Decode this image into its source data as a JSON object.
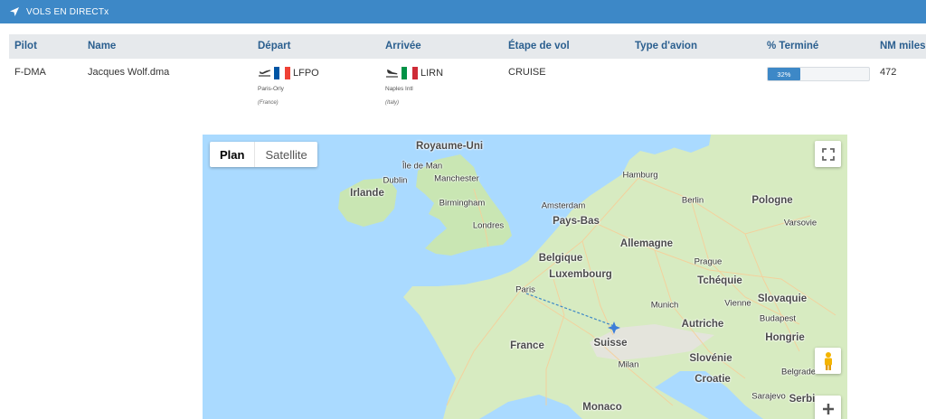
{
  "header": {
    "title": "VOLS EN DIRECTx",
    "icon": "navigation-arrow-icon",
    "color": "#3d88c7"
  },
  "table": {
    "columns": [
      "Pilot",
      "Name",
      "Départ",
      "Arrivée",
      "Étape de vol",
      "Type d'avion",
      "% Terminé",
      "NM miles a"
    ],
    "row": {
      "pilot": "F-DMA",
      "name": "Jacques Wolf.dma",
      "departure": {
        "code": "LFPO",
        "name": "Paris-Orly",
        "country": "(France)",
        "flag": "france-flag-icon"
      },
      "arrival": {
        "code": "LIRN",
        "name": "Naples Intl",
        "country": "(Italy)",
        "flag": "italy-flag-icon"
      },
      "phase": "CRUISE",
      "aircraft": "",
      "progress_label": "32%",
      "progress": 0.32,
      "nm": "472"
    }
  },
  "map": {
    "type_buttons": [
      "Plan",
      "Satellite"
    ],
    "active_type": "Plan",
    "labels": {
      "uk": "Royaume-Uni",
      "iom": "Île de Man",
      "ireland": "Irlande",
      "dublin": "Dublin",
      "manchester": "Manchester",
      "birmingham": "Birmingham",
      "london": "Londres",
      "hamburg": "Hamburg",
      "berlin": "Berlin",
      "poland": "Pologne",
      "warsaw": "Varsovie",
      "amsterdam": "Amsterdam",
      "netherlands": "Pays-Bas",
      "germany": "Allemagne",
      "belgium": "Belgique",
      "luxembourg": "Luxembourg",
      "prague": "Prague",
      "czech": "Tchéquie",
      "paris": "Paris",
      "munich": "Munich",
      "vienna": "Vienne",
      "slovakia": "Slovaquie",
      "budapest": "Budapest",
      "austria": "Autriche",
      "hungary": "Hongrie",
      "france": "France",
      "switzerland": "Suisse",
      "slovenia": "Slovénie",
      "milan": "Milan",
      "croatia": "Croatie",
      "belgrade": "Belgrade",
      "sarajevo": "Sarajevo",
      "serbia": "Serbi",
      "monaco": "Monaco"
    }
  }
}
